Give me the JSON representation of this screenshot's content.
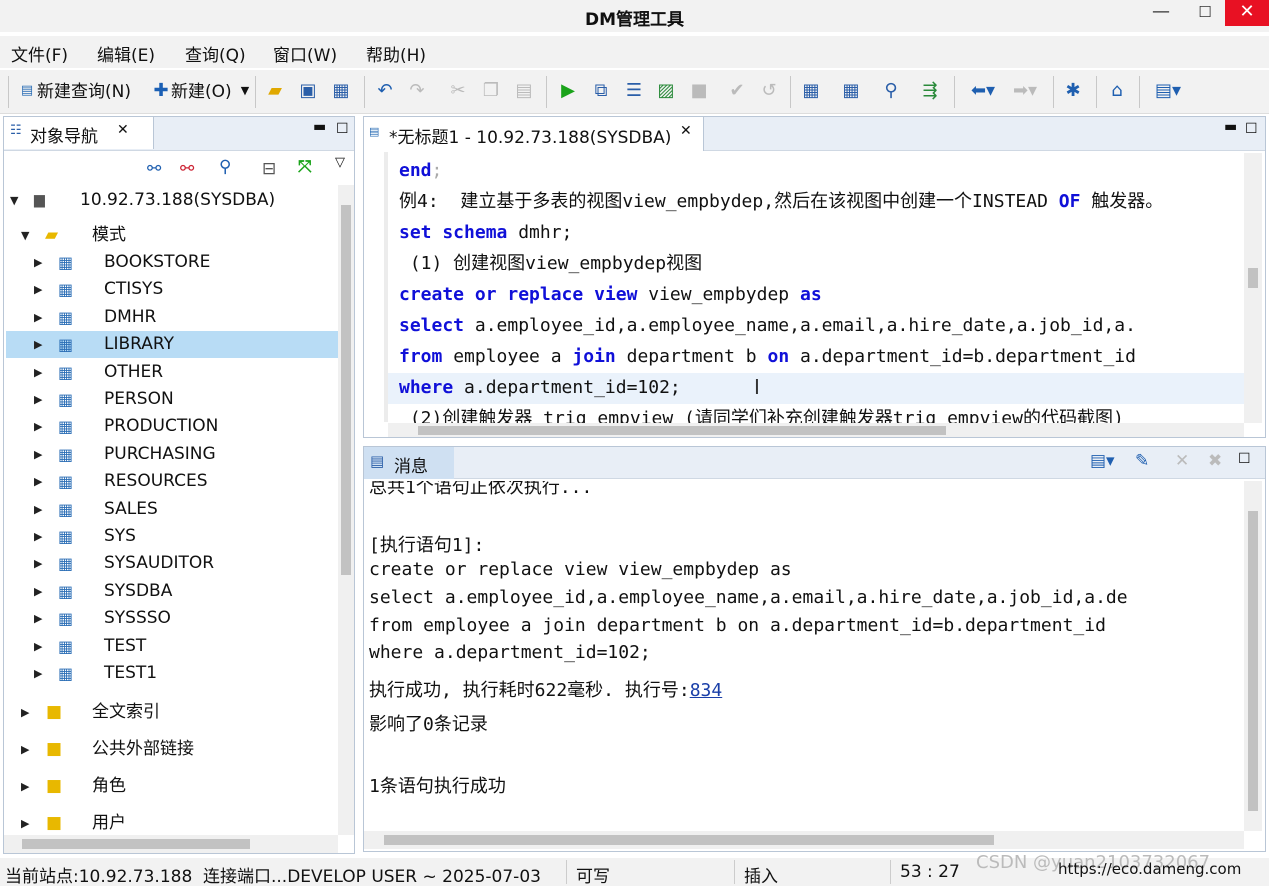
{
  "window": {
    "title": "DM管理工具",
    "min": "—",
    "max": "☐",
    "close": "✕"
  },
  "menu": [
    "文件(F)",
    "编辑(E)",
    "查询(Q)",
    "窗口(W)",
    "帮助(H)"
  ],
  "toolbar": {
    "new_query": "新建查询(N)",
    "new": "新建(O)"
  },
  "nav": {
    "tab_label": "对象导航",
    "server": "10.92.73.188(SYSDBA)",
    "schema_folder": "模式",
    "schemas": [
      "BOOKSTORE",
      "CTISYS",
      "DMHR",
      "LIBRARY",
      "OTHER",
      "PERSON",
      "PRODUCTION",
      "PURCHASING",
      "RESOURCES",
      "SALES",
      "SYS",
      "SYSAUDITOR",
      "SYSDBA",
      "SYSSSO",
      "TEST",
      "TEST1"
    ],
    "selected": "LIBRARY",
    "folders": [
      "全文索引",
      "公共外部链接",
      "角色",
      "用户"
    ]
  },
  "editor": {
    "tab_label": "*无标题1 - 10.92.73.188(SYSDBA)",
    "lines": {
      "l1_kw": "end",
      "l1_rest": ";",
      "l2_a": "例4:  建立基于多表的视图view_empbydep,然后在该视图中创建一个INSTEAD ",
      "l2_kw": "OF",
      "l2_b": " 触发器。",
      "l3_kw": "set schema",
      "l3_rest": " dmhr;",
      "l4": " (1) 创建视图view_empbydep视图",
      "l5_kw1": "create or replace view",
      "l5_mid": " view_empbydep ",
      "l5_kw2": "as",
      "l6_kw": "select",
      "l6_rest": " a.employee_id,a.employee_name,a.email,a.hire_date,a.job_id,a.",
      "l7_kw1": "from",
      "l7_a": " employee a ",
      "l7_kw2": "join",
      "l7_b": " department b ",
      "l7_kw3": "on",
      "l7_c": " a.department_id=b.department_id",
      "l8_kw": "where",
      "l8_rest": " a.department_id=102;",
      "l9": " (2)创建触发器 trig_empview (请同学们补充创建触发器trig_empview的代码截图)"
    }
  },
  "messages": {
    "tab_label": "消息",
    "lines": [
      "总共1个语句正依次执行...",
      "",
      "[执行语句1]:",
      "create or replace view view_empbydep as",
      "select a.employee_id,a.employee_name,a.email,a.hire_date,a.job_id,a.de",
      "from employee a join department b on a.department_id=b.department_id",
      "where a.department_id=102;"
    ],
    "success_prefix": "执行成功, 执行耗时622毫秒. 执行号:",
    "exec_no": "834",
    "affected": "影响了0条记录",
    "summary": "1条语句执行成功"
  },
  "status": {
    "site": "当前站点:10.92.73.188",
    "conn": "连接端口...DEVELOP USER ~ 2025-07-03",
    "mode": "可写",
    "insert": "插入",
    "pos": "53 : 27",
    "watermark": "CSDN @yuan2103732067",
    "url": "https://eco.dameng.com"
  }
}
